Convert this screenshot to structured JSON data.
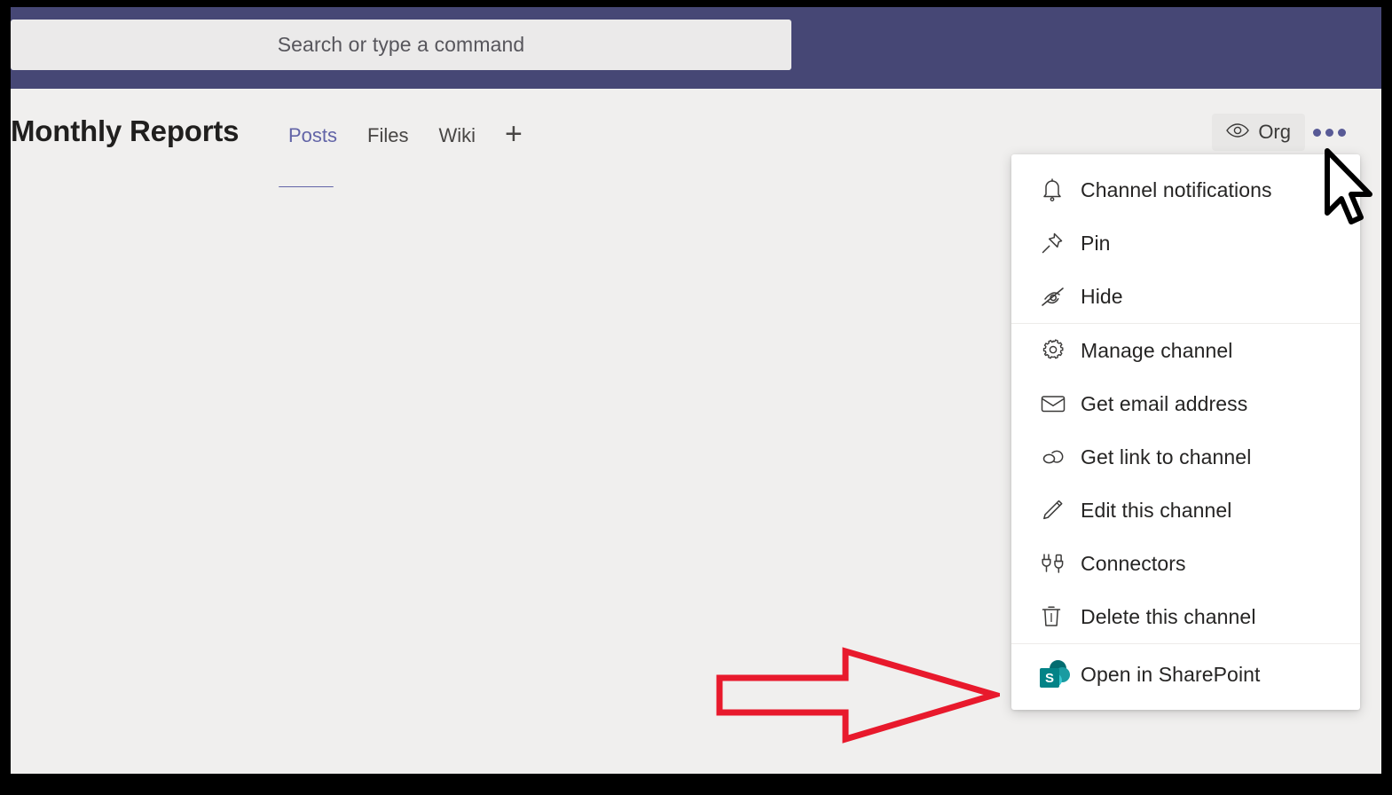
{
  "window": {
    "accent_purple": "#464775",
    "tab_accent": "#6264A7",
    "surface": "#F0EFEE"
  },
  "search": {
    "placeholder": "Search or type a command",
    "value": ""
  },
  "channel": {
    "title": "Monthly Reports",
    "tabs": [
      {
        "label": "Posts",
        "active": true
      },
      {
        "label": "Files",
        "active": false
      },
      {
        "label": "Wiki",
        "active": false
      }
    ],
    "add_tab_label": "+",
    "org_button": {
      "label": "Org",
      "icon": "eye-icon"
    },
    "more_button": {
      "label": "More options",
      "icon": "ellipsis-icon"
    }
  },
  "menu": {
    "groups": [
      {
        "items": [
          {
            "label": "Channel notifications",
            "icon": "bell-icon"
          },
          {
            "label": "Pin",
            "icon": "pin-icon"
          },
          {
            "label": "Hide",
            "icon": "eye-off-icon"
          }
        ]
      },
      {
        "items": [
          {
            "label": "Manage channel",
            "icon": "gear-icon"
          },
          {
            "label": "Get email address",
            "icon": "envelope-icon"
          },
          {
            "label": "Get link to channel",
            "icon": "link-icon"
          },
          {
            "label": "Edit this channel",
            "icon": "pencil-icon"
          },
          {
            "label": "Connectors",
            "icon": "connectors-icon"
          },
          {
            "label": "Delete this channel",
            "icon": "trash-icon"
          }
        ]
      },
      {
        "items": [
          {
            "label": "Open in SharePoint",
            "icon": "sharepoint-icon",
            "icon_letter": "S"
          }
        ]
      }
    ]
  },
  "annotation": {
    "arrow_color": "#E8192C",
    "points_to": "Open in SharePoint"
  }
}
